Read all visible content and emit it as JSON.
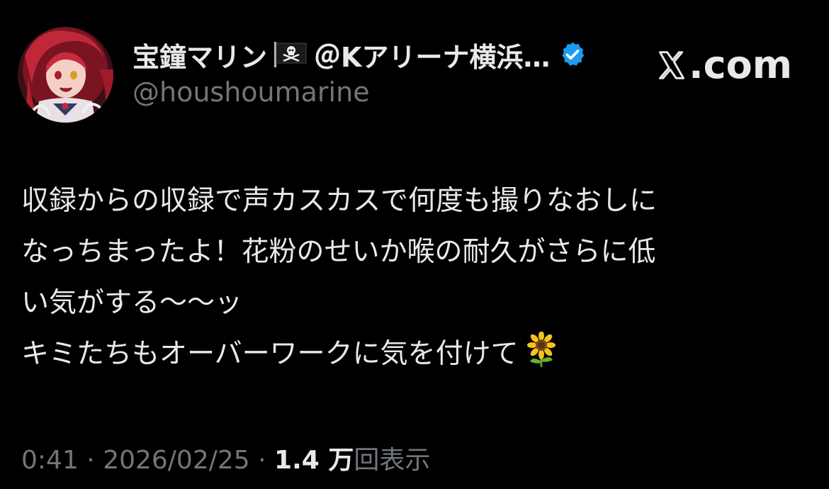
{
  "author": {
    "display_name": "宝鐘マリン",
    "flag_icon": "pirate-flag-icon",
    "display_name_suffix": "＠Kアリーナ横浜…",
    "verified_icon": "verified-badge-icon",
    "verified_color": "#1d9bf0",
    "handle": "@houshoumarine"
  },
  "site": {
    "logo_icon": "x-logo-icon",
    "label": ".com"
  },
  "tweet": {
    "lines": [
      "収録からの収録で声カスカスで何度も撮りなおしに",
      "なっちまったよ！花粉のせいか喉の耐久がさらに低",
      "い気がする〜〜ッ",
      "キミたちもオーバーワークに気を付けて"
    ],
    "trailing_emoji_icon": "sunflower-icon"
  },
  "meta": {
    "time": "0:41",
    "separator": " · ",
    "date": "2026/02/25",
    "views_count": "1.4 万",
    "views_label": "回表示"
  },
  "colors": {
    "background": "#000000",
    "text_primary": "#e7e9ea",
    "text_secondary": "#71767b"
  }
}
